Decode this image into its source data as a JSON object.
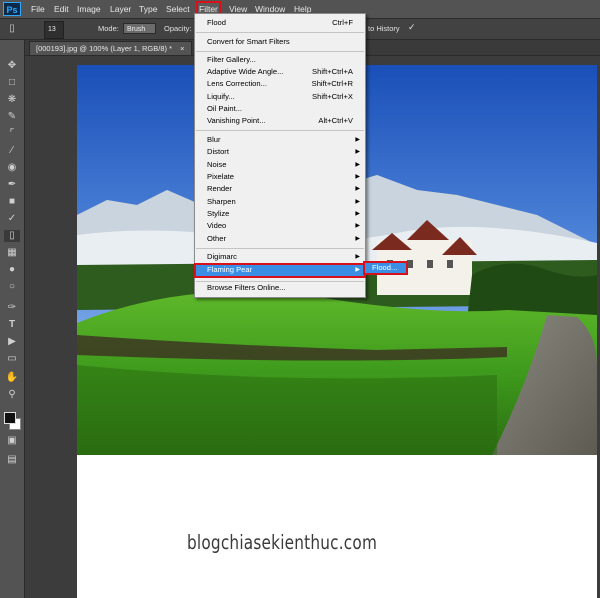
{
  "app": {
    "logo": "Ps"
  },
  "menubar": {
    "items": [
      "File",
      "Edit",
      "Image",
      "Layer",
      "Type",
      "Select",
      "Filter",
      "View",
      "Window",
      "Help"
    ]
  },
  "options": {
    "brush_size": "13",
    "mode_label": "Mode:",
    "mode_value": "Brush",
    "opacity_label": "Opacity:",
    "history_label": "to History"
  },
  "document": {
    "tab_title": "[000193].jpg @ 100% (Layer 1, RGB/8) *"
  },
  "filter_menu": {
    "items": [
      {
        "label": "Flood",
        "shortcut": "Ctrl+F"
      },
      {
        "label": "Convert for Smart Filters",
        "shortcut": ""
      },
      {
        "label": "Filter Gallery...",
        "shortcut": ""
      },
      {
        "label": "Adaptive Wide Angle...",
        "shortcut": "Shift+Ctrl+A"
      },
      {
        "label": "Lens Correction...",
        "shortcut": "Shift+Ctrl+R"
      },
      {
        "label": "Liquify...",
        "shortcut": "Shift+Ctrl+X"
      },
      {
        "label": "Oil Paint...",
        "shortcut": ""
      },
      {
        "label": "Vanishing Point...",
        "shortcut": "Alt+Ctrl+V"
      },
      {
        "label": "Blur",
        "shortcut": ""
      },
      {
        "label": "Distort",
        "shortcut": ""
      },
      {
        "label": "Noise",
        "shortcut": ""
      },
      {
        "label": "Pixelate",
        "shortcut": ""
      },
      {
        "label": "Render",
        "shortcut": ""
      },
      {
        "label": "Sharpen",
        "shortcut": ""
      },
      {
        "label": "Stylize",
        "shortcut": ""
      },
      {
        "label": "Video",
        "shortcut": ""
      },
      {
        "label": "Other",
        "shortcut": ""
      },
      {
        "label": "Digimarc",
        "shortcut": ""
      },
      {
        "label": "Flaming Pear",
        "shortcut": ""
      },
      {
        "label": "Browse Filters Online...",
        "shortcut": ""
      }
    ],
    "submenu_item": "Flood..."
  },
  "watermark": "blogchiasekienthuc.com",
  "colors": {
    "highlight": "#3a8fe5",
    "callout_red": "#d8101a",
    "menubar": "#535353",
    "canvas": "#ffffff"
  }
}
